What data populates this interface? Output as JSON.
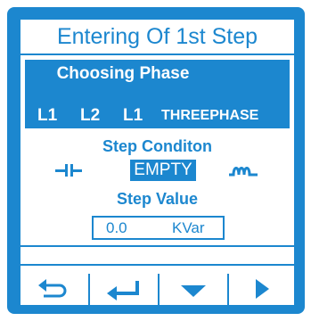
{
  "header": {
    "title": "Entering Of 1st Step"
  },
  "phase": {
    "title": "Choosing Phase",
    "options": [
      "L1",
      "L2",
      "L1",
      "THREEPHASE"
    ]
  },
  "step_condition": {
    "label": "Step Conditon",
    "value": "EMPTY",
    "left_icon": "capacitor-icon",
    "right_icon": "inductor-coil-icon"
  },
  "step_value": {
    "label": "Step Value",
    "value": "0.0",
    "unit": "KVar"
  },
  "softkeys": [
    "back-arrow-icon",
    "enter-arrow-icon",
    "down-triangle-icon",
    "right-triangle-icon"
  ],
  "colors": {
    "accent": "#1c87cf",
    "background": "#ffffff"
  }
}
